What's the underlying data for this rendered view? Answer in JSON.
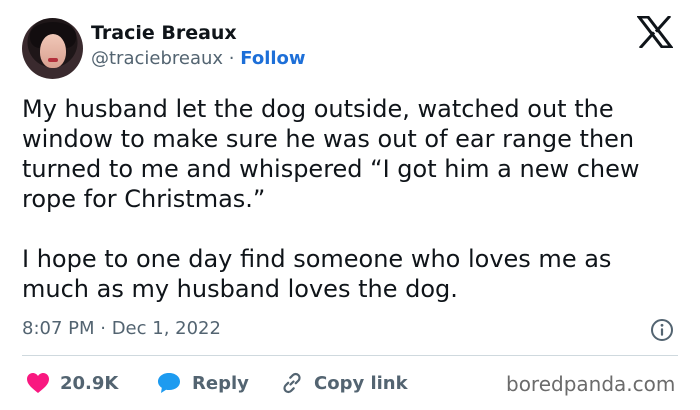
{
  "author": {
    "name": "Tracie Breaux",
    "handle": "@traciebreaux",
    "separator": "·",
    "follow_label": "Follow"
  },
  "tweet": {
    "paragraph_1": "My husband let the dog outside, watched out the window to make sure he was out of ear range then turned to me and whispered “I got him a new chew rope for Christmas.”",
    "paragraph_2": "I hope to one day find someone who loves me as much as my husband loves the dog.",
    "time": "8:07 PM · Dec 1, 2022"
  },
  "actions": {
    "likes": "20.9K",
    "reply_label": "Reply",
    "copy_link_label": "Copy link"
  },
  "watermark": "boredpanda.com",
  "icons": {
    "platform": "x-logo-icon",
    "like": "heart-icon",
    "reply": "speech-bubble-icon",
    "copy": "link-icon",
    "info": "info-icon"
  },
  "colors": {
    "like": "#f91880",
    "reply": "#1d9bf0",
    "follow": "#1d6fd8",
    "secondary_text": "#536471"
  }
}
